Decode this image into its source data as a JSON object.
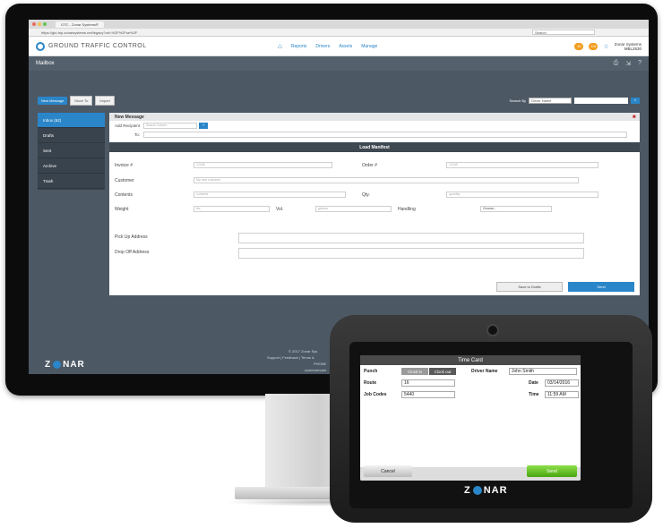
{
  "browser": {
    "tab_title": "GTC - Zonar Systems®",
    "url": "https://gtc-trip.zonarsystems.net/legacy?url=%2F%2Fse%2F",
    "search_placeholder": "Search"
  },
  "app": {
    "logo_text": "GROUND TRAFFIC CONTROL",
    "nav": [
      "Reports",
      "Drivers",
      "Assets",
      "Manage"
    ],
    "badges": [
      "60",
      "104"
    ],
    "badge_colors": [
      "#f29d1e",
      "#f29d1e"
    ],
    "user_name": "Zonar Systems",
    "user_code": "MBL2630"
  },
  "mailbox": {
    "title": "Mailbox",
    "new_message": "New Message",
    "move_to": "Move To",
    "import": "Import",
    "search_by_label": "Search By",
    "search_by_value": "Driver Name"
  },
  "sidebar": [
    "Inbox (62)",
    "Drafts",
    "Sent",
    "Archive",
    "Trash"
  ],
  "message": {
    "title": "New Message",
    "add_recipient": "Add Recipient",
    "recipient_placeholder": "Search Drivers",
    "to_label": "To:",
    "manifest_title": "Load Manifest",
    "invoice_label": "Invoice #",
    "invoice_ph": "12345",
    "order_label": "Order #",
    "order_ph": "12345",
    "customer_label": "Customer",
    "customer_ph": "My new customer",
    "contents_label": "Contents",
    "contents_ph": "contents",
    "qty_label": "Qty.",
    "qty_ph": "quantity",
    "weight_label": "Weight",
    "weight_ph": "lbs",
    "vol_label": "Vol.",
    "vol_ph": "gallons",
    "handling_label": "Handling",
    "handling_value": "Choose...",
    "pickup_label": "Pick Up Address",
    "dropoff_label": "Drop Off Address",
    "save_drafts": "Save to Drafts",
    "send": "Send"
  },
  "footer": {
    "copyright": "© 2017 Zonar Sys",
    "links": "Support | Feedback | Terms &",
    "phone": "PHONE",
    "email": "customercare"
  },
  "brand": "ZONAR",
  "device": {
    "title": "Time Card",
    "punch_label": "Punch",
    "clock_in": "Clock in",
    "clock_out": "Clock out",
    "driver_label": "Driver Name",
    "driver_value": "John Smith",
    "route_label": "Route",
    "route_value": "16",
    "date_label": "Date",
    "date_value": "03/14/2016",
    "job_label": "Job Codes",
    "job_value": "5440",
    "time_label": "Time",
    "time_value": "11:59 AM",
    "cancel": "Cancel",
    "send": "Send",
    "brand": "ZONAR"
  }
}
